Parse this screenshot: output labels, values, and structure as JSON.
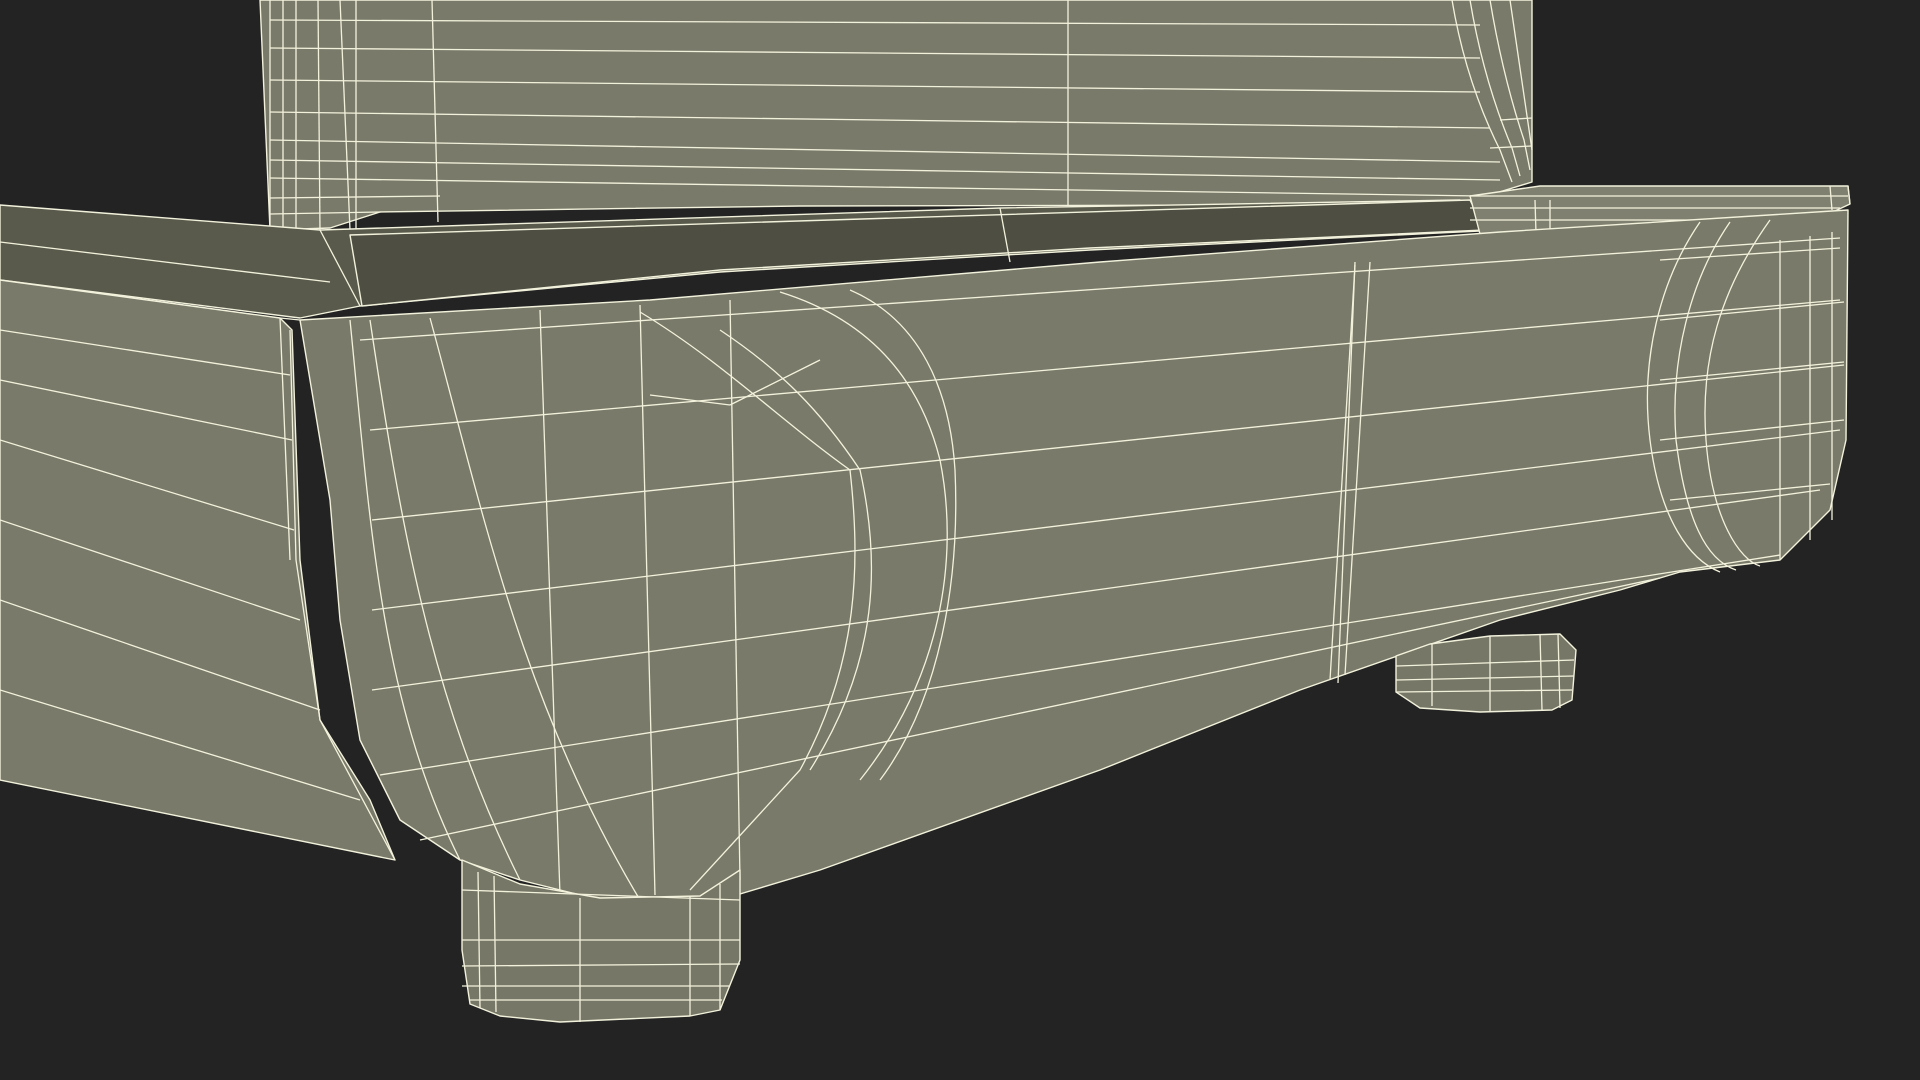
{
  "scene": {
    "subject": "wireframe-3d-model",
    "viewport_background": "#232323",
    "colors": {
      "surface_main": "#7a7a6a",
      "surface_light": "#808070",
      "surface_shadow": "#5a5a4c",
      "surface_dark": "#4e4e42",
      "wire": "#f2f2dc"
    }
  }
}
